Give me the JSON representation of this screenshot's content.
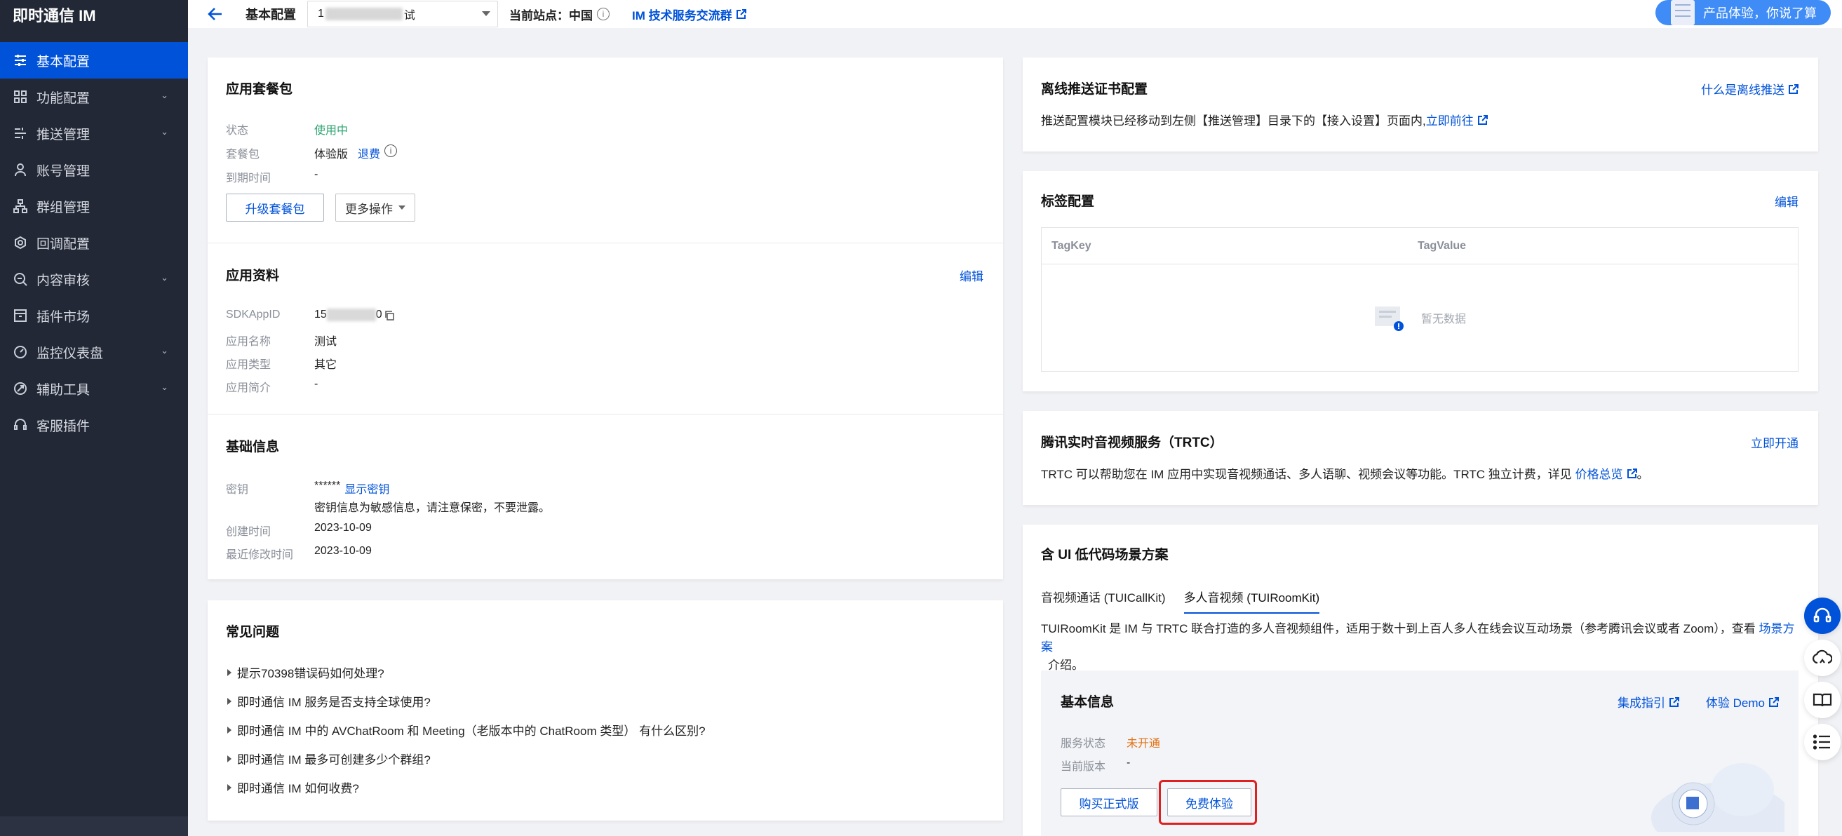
{
  "sidebar": {
    "brand": "即时通信 IM",
    "items": [
      {
        "label": "基本配置",
        "icon": "sliders-icon",
        "active": true,
        "has_children": false
      },
      {
        "label": "功能配置",
        "icon": "grid-icon",
        "active": false,
        "has_children": true
      },
      {
        "label": "推送管理",
        "icon": "list-settings-icon",
        "active": false,
        "has_children": true
      },
      {
        "label": "账号管理",
        "icon": "user-icon",
        "active": false,
        "has_children": false
      },
      {
        "label": "群组管理",
        "icon": "org-chart-icon",
        "active": false,
        "has_children": false
      },
      {
        "label": "回调配置",
        "icon": "callback-icon",
        "active": false,
        "has_children": false
      },
      {
        "label": "内容审核",
        "icon": "search-shield-icon",
        "active": false,
        "has_children": true
      },
      {
        "label": "插件市场",
        "icon": "store-icon",
        "active": false,
        "has_children": false
      },
      {
        "label": "监控仪表盘",
        "icon": "gauge-icon",
        "active": false,
        "has_children": true
      },
      {
        "label": "辅助工具",
        "icon": "tool-icon",
        "active": false,
        "has_children": true
      },
      {
        "label": "客服插件",
        "icon": "headset-icon",
        "active": false,
        "has_children": false
      }
    ]
  },
  "topbar": {
    "title": "基本配置",
    "app_select_prefix": "1",
    "app_select_suffix": "试",
    "site_label": "当前站点：中国",
    "group_link": "IM 技术服务交流群",
    "feedback": "产品体验，你说了算"
  },
  "package_card": {
    "title": "应用套餐包",
    "status_label": "状态",
    "status_value": "使用中",
    "plan_label": "套餐包",
    "plan_value": "体验版",
    "refund": "退费",
    "expire_label": "到期时间",
    "expire_value": "-",
    "upgrade_btn": "升级套餐包",
    "more_btn": "更多操作"
  },
  "app_info": {
    "title": "应用资料",
    "edit": "编辑",
    "sdk_label": "SDKAppID",
    "sdk_prefix": "15",
    "sdk_suffix": "0",
    "name_label": "应用名称",
    "name_value": "测试",
    "type_label": "应用类型",
    "type_value": "其它",
    "desc_label": "应用简介",
    "desc_value": "-"
  },
  "basic_info": {
    "title": "基础信息",
    "key_label": "密钥",
    "key_value": "******",
    "show_key": "显示密钥",
    "key_note": "密钥信息为敏感信息，请注意保密，不要泄露。",
    "created_label": "创建时间",
    "created_value": "2023-10-09",
    "modified_label": "最近修改时间",
    "modified_value": "2023-10-09"
  },
  "faq": {
    "title": "常见问题",
    "items": [
      "提示70398错误码如何处理?",
      "即时通信 IM 服务是否支持全球使用?",
      "即时通信 IM 中的 AVChatRoom 和 Meeting（老版本中的 ChatRoom 类型） 有什么区别?",
      "即时通信 IM 最多可创建多少个群组?",
      "即时通信 IM 如何收费?"
    ]
  },
  "push_card": {
    "title": "离线推送证书配置",
    "link": "什么是离线推送",
    "text": "推送配置模块已经移动到左侧【推送管理】目录下的【接入设置】页面内,",
    "goto": "立即前往"
  },
  "tag_card": {
    "title": "标签配置",
    "edit": "编辑",
    "col_key": "TagKey",
    "col_value": "TagValue",
    "empty": "暂无数据"
  },
  "trtc_card": {
    "title": "腾讯实时音视频服务（TRTC）",
    "open": "立即开通",
    "text": "TRTC 可以帮助您在 IM 应用中实现音视频通话、多人语聊、视频会议等功能。TRTC 独立计费，详见",
    "price_link": "价格总览",
    "text_end": "。"
  },
  "ui_card": {
    "title": "含 UI 低代码场景方案",
    "tabs": [
      "音视频通话 (TUICallKit)",
      "多人音视频 (TUIRoomKit)"
    ],
    "active_tab": 1,
    "desc_line1": "TUIRoomKit 是 IM 与 TRTC 联合打造的多人音视频组件，适用于数十到上百人多人在线会议互动场景（参考腾讯会议或者 Zoom），查看",
    "scene_link": "场景方案",
    "desc_line2": "介绍。",
    "inner": {
      "title": "基本信息",
      "guide_link": "集成指引",
      "demo_link": "体验 Demo",
      "status_label": "服务状态",
      "status_value": "未开通",
      "version_label": "当前版本",
      "version_value": "-",
      "buy_btn": "购买正式版",
      "free_btn": "免费体验"
    }
  },
  "floating": [
    "headset-icon",
    "cloud-icon",
    "book-icon",
    "list-icon"
  ],
  "colors": {
    "accent": "#0052d9",
    "sidebar": "#222836",
    "highlight": "#e02020"
  }
}
